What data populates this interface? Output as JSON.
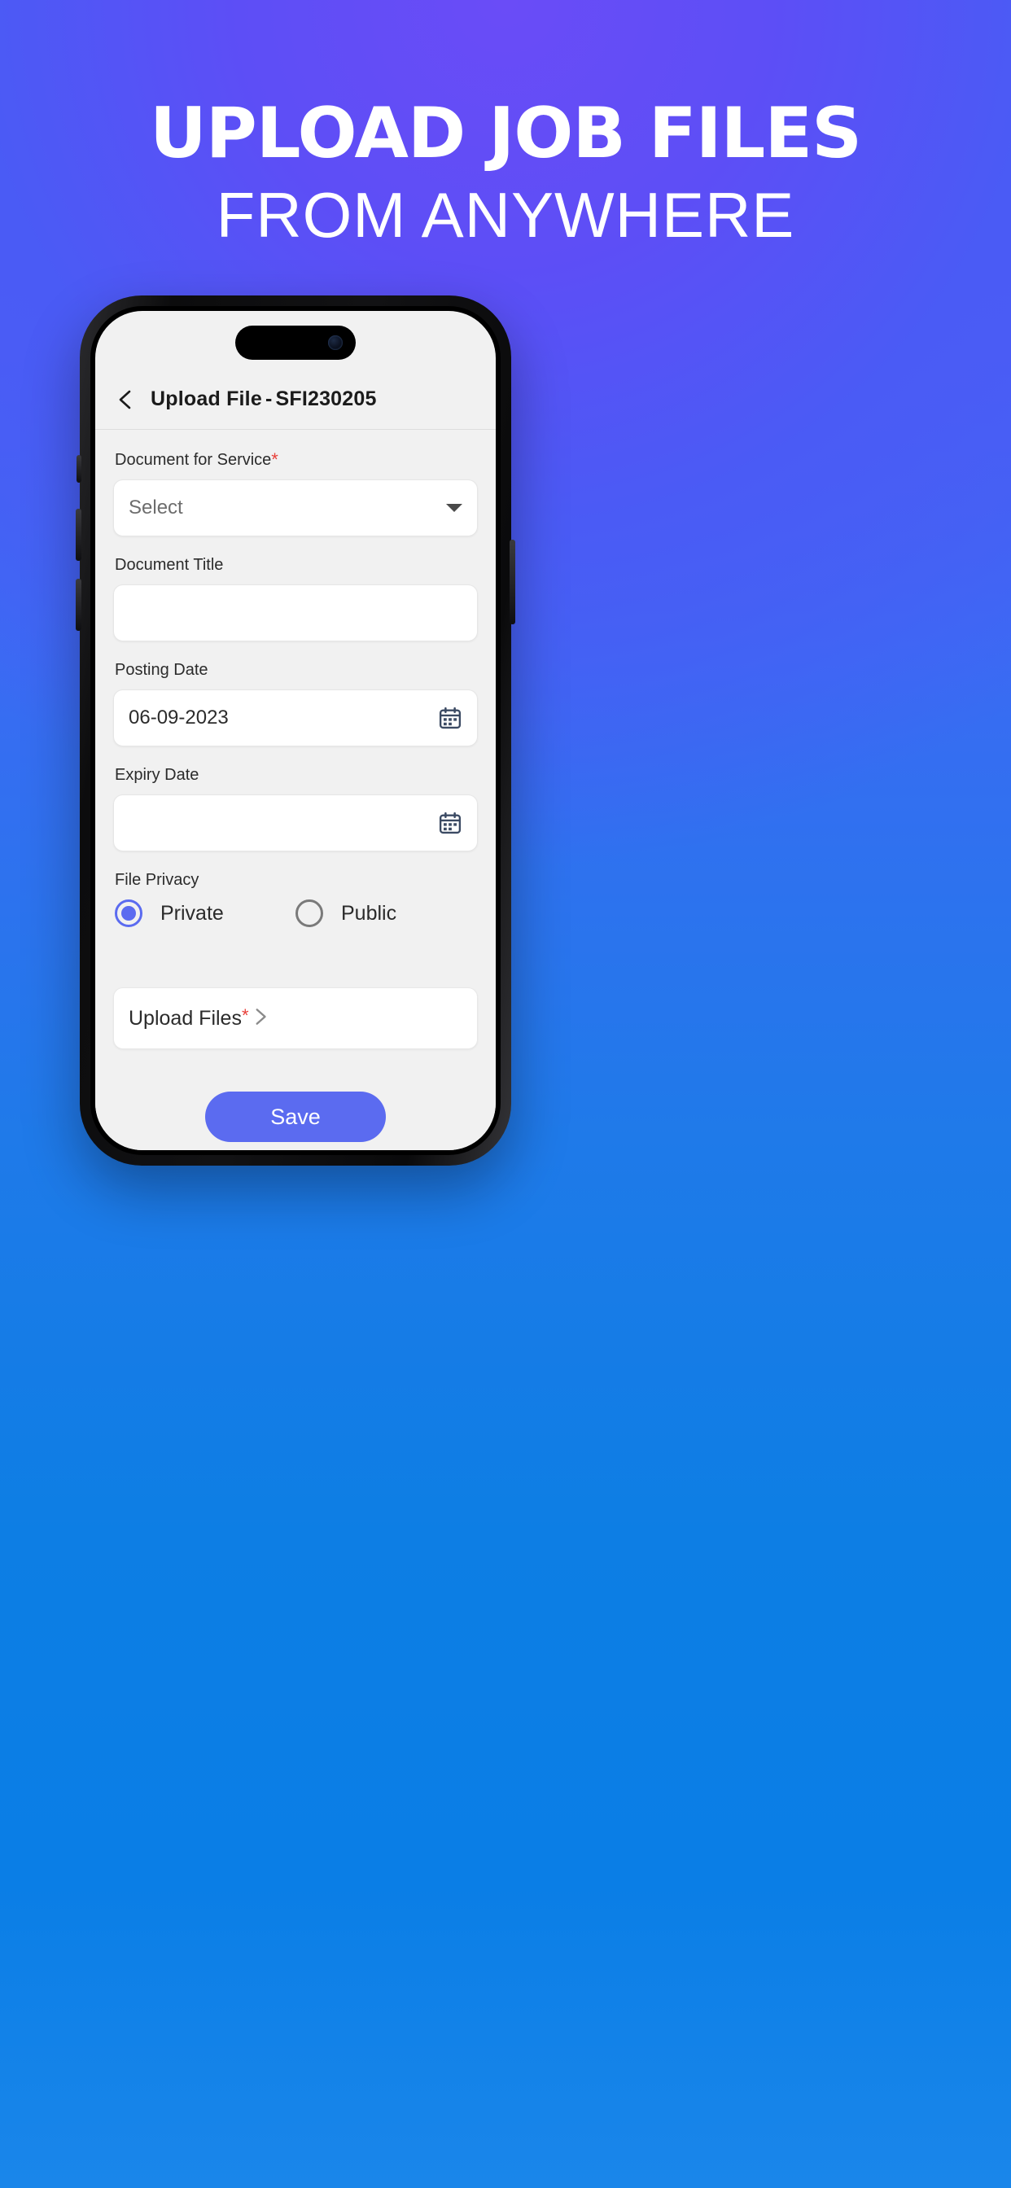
{
  "promo": {
    "headline_line1": "UPLOAD JOB FILES",
    "headline_line2": "FROM ANYWHERE",
    "bg_gradient_from": "#5B4BF6",
    "bg_gradient_to": "#0A7EE6"
  },
  "app": {
    "header": {
      "back_icon": "chevron-left-icon",
      "title": "Upload File",
      "separator": "-",
      "job_id": "SFI230205"
    },
    "form": {
      "document_for_service": {
        "label": "Document for Service",
        "required_marker": "*",
        "placeholder": "Select",
        "value": "",
        "dropdown_icon": "chevron-down-icon"
      },
      "document_title": {
        "label": "Document Title",
        "value": "",
        "placeholder": ""
      },
      "posting_date": {
        "label": "Posting Date",
        "value": "06-09-2023",
        "icon": "calendar-icon"
      },
      "expiry_date": {
        "label": "Expiry Date",
        "value": "",
        "icon": "calendar-icon"
      },
      "file_privacy": {
        "label": "File Privacy",
        "selected": "Private",
        "options": [
          "Private",
          "Public"
        ]
      },
      "upload_files": {
        "label": "Upload Files",
        "required_marker": "*",
        "chevron_icon": "chevron-right-icon"
      },
      "save_button": {
        "label": "Save",
        "color": "#5B6BF0"
      }
    }
  }
}
